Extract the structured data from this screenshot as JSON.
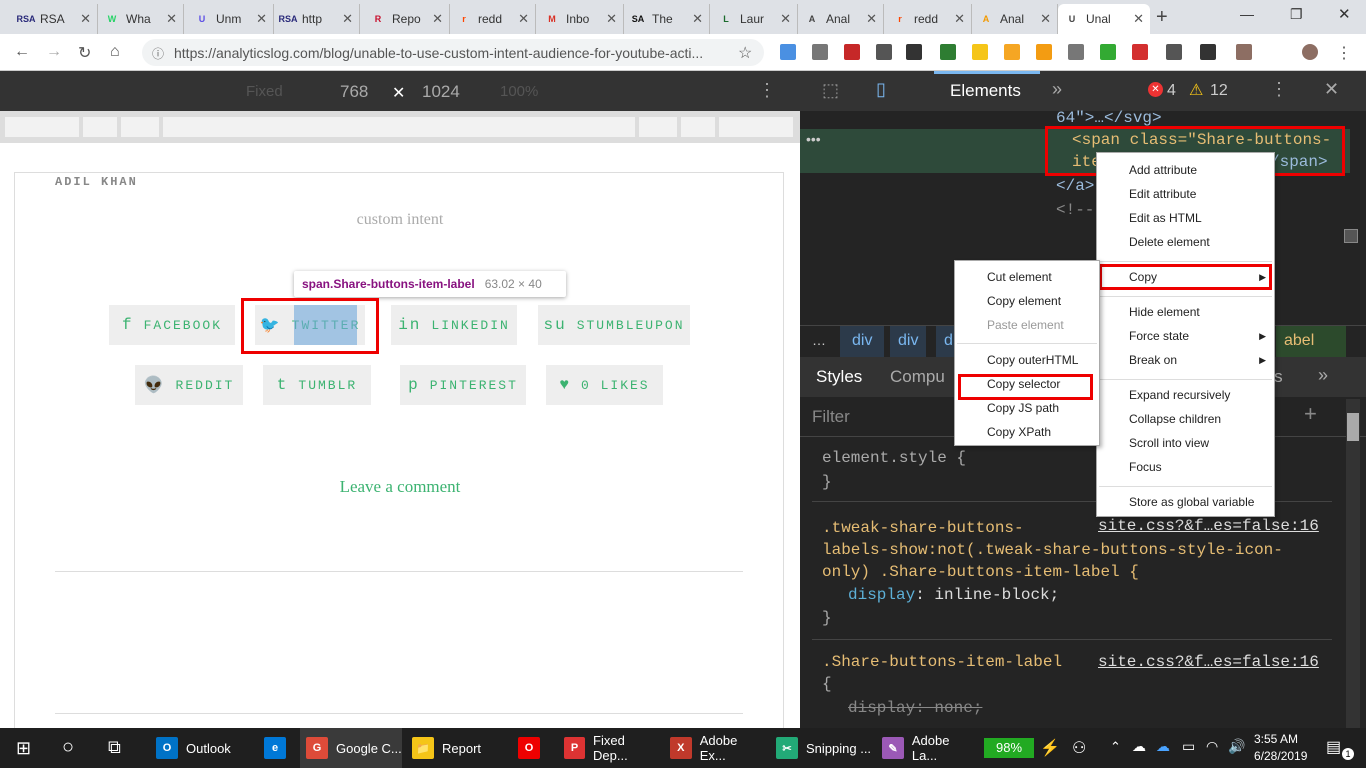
{
  "tabs": [
    {
      "label": "RSA",
      "fav": "RSA",
      "color": "#2a2a7a"
    },
    {
      "label": "Wha",
      "fav": "W",
      "color": "#25d366"
    },
    {
      "label": "Unm",
      "fav": "U",
      "color": "#5c4ee5"
    },
    {
      "label": "http",
      "fav": "RSA",
      "color": "#2a2a7a"
    },
    {
      "label": "Repo",
      "fav": "R",
      "color": "#c8102e"
    },
    {
      "label": "redd",
      "fav": "r",
      "color": "#ff4500"
    },
    {
      "label": "Inbo",
      "fav": "M",
      "color": "#d93025"
    },
    {
      "label": "The",
      "fav": "SA",
      "color": "#111"
    },
    {
      "label": "Laur",
      "fav": "L",
      "color": "#1a6b2c"
    },
    {
      "label": "Anal",
      "fav": "A",
      "color": "#444"
    },
    {
      "label": "redd",
      "fav": "r",
      "color": "#ff4500"
    },
    {
      "label": "Anal",
      "fav": "A",
      "color": "#f29900"
    },
    {
      "label": "Unal",
      "fav": "U",
      "color": "#444"
    }
  ],
  "url": "https://analyticslog.com/blog/unable-to-use-custom-intent-audience-for-youtube-acti...",
  "device": {
    "label": "Fixed",
    "width": "768",
    "height": "1024",
    "zoom": "100%"
  },
  "page": {
    "author": "ADIL KHAN",
    "tag": "custom intent",
    "tooltip_el": "span.Share-buttons-item-label",
    "tooltip_size": "63.02 × 40",
    "leave_comment": "Leave a comment"
  },
  "share_buttons": [
    {
      "label": "FACEBOOK",
      "icon": "f"
    },
    {
      "label": "TWITTER",
      "icon": "🐦"
    },
    {
      "label": "LINKEDIN",
      "icon": "in"
    },
    {
      "label": "STUMBLEUPON",
      "icon": "su"
    },
    {
      "label": "REDDIT",
      "icon": "👽"
    },
    {
      "label": "TUMBLR",
      "icon": "t"
    },
    {
      "label": "PINTEREST",
      "icon": "p"
    },
    {
      "label": "0 LIKES",
      "icon": "♥"
    }
  ],
  "devtools": {
    "tab": "Elements",
    "errors": "4",
    "warnings": "12",
    "code_line1": "64\">…</svg>",
    "code_line2": "<span class=\"Share-buttons-",
    "code_line3": "ite",
    "code_line3b": "/span>",
    "code_line4": "</a>",
    "code_line5": "<!--",
    "crumbs": [
      "div",
      "div",
      "d",
      "abel"
    ],
    "styles_tab": "Styles",
    "computed_tab": "Compu",
    "events_tab": "nts",
    "filter": "Filter",
    "rule1": "element.style {",
    "rule1_close": "}",
    "rule2_sel": ".tweak-share-buttons-\nlabels-show:not(.tweak-share-buttons-style-icon-\nonly) .Share-buttons-item-label {",
    "rule2_src": "site.css?&f…es=false:16",
    "rule2_prop": "display",
    "rule2_val": "inline-block;",
    "rule2_close": "}",
    "rule3_sel": ".Share-buttons-item-label",
    "rule3_src": "site.css?&f…es=false:16",
    "rule3_open": "{",
    "rule3_prop": "display: none;"
  },
  "menu_main": [
    "Add attribute",
    "Edit attribute",
    "Edit as HTML",
    "Delete element",
    "Copy",
    "Hide element",
    "Force state",
    "Break on",
    "Expand recursively",
    "Collapse children",
    "Scroll into view",
    "Focus",
    "Store as global variable"
  ],
  "menu_copy": [
    "Cut element",
    "Copy element",
    "Paste element",
    "Copy outerHTML",
    "Copy selector",
    "Copy JS path",
    "Copy XPath"
  ],
  "taskbar": [
    {
      "label": "Outlook",
      "icon": "O",
      "color": "#0072c6"
    },
    {
      "label": "",
      "icon": "e",
      "color": "#0078d7"
    },
    {
      "label": "Google C...",
      "icon": "G",
      "color": "#dd4b39"
    },
    {
      "label": "Report",
      "icon": "📁",
      "color": "#f5c518"
    },
    {
      "label": "",
      "icon": "O",
      "color": "#e00"
    },
    {
      "label": "Fixed Dep...",
      "icon": "P",
      "color": "#d33"
    },
    {
      "label": "Adobe Ex...",
      "icon": "X",
      "color": "#c0392b"
    },
    {
      "label": "Snipping ...",
      "icon": "✂",
      "color": "#2a7"
    },
    {
      "label": "Adobe La...",
      "icon": "✎",
      "color": "#9b59b6"
    }
  ],
  "battery": "98%",
  "time": "3:55 AM",
  "date": "6/28/2019",
  "notif": "1"
}
